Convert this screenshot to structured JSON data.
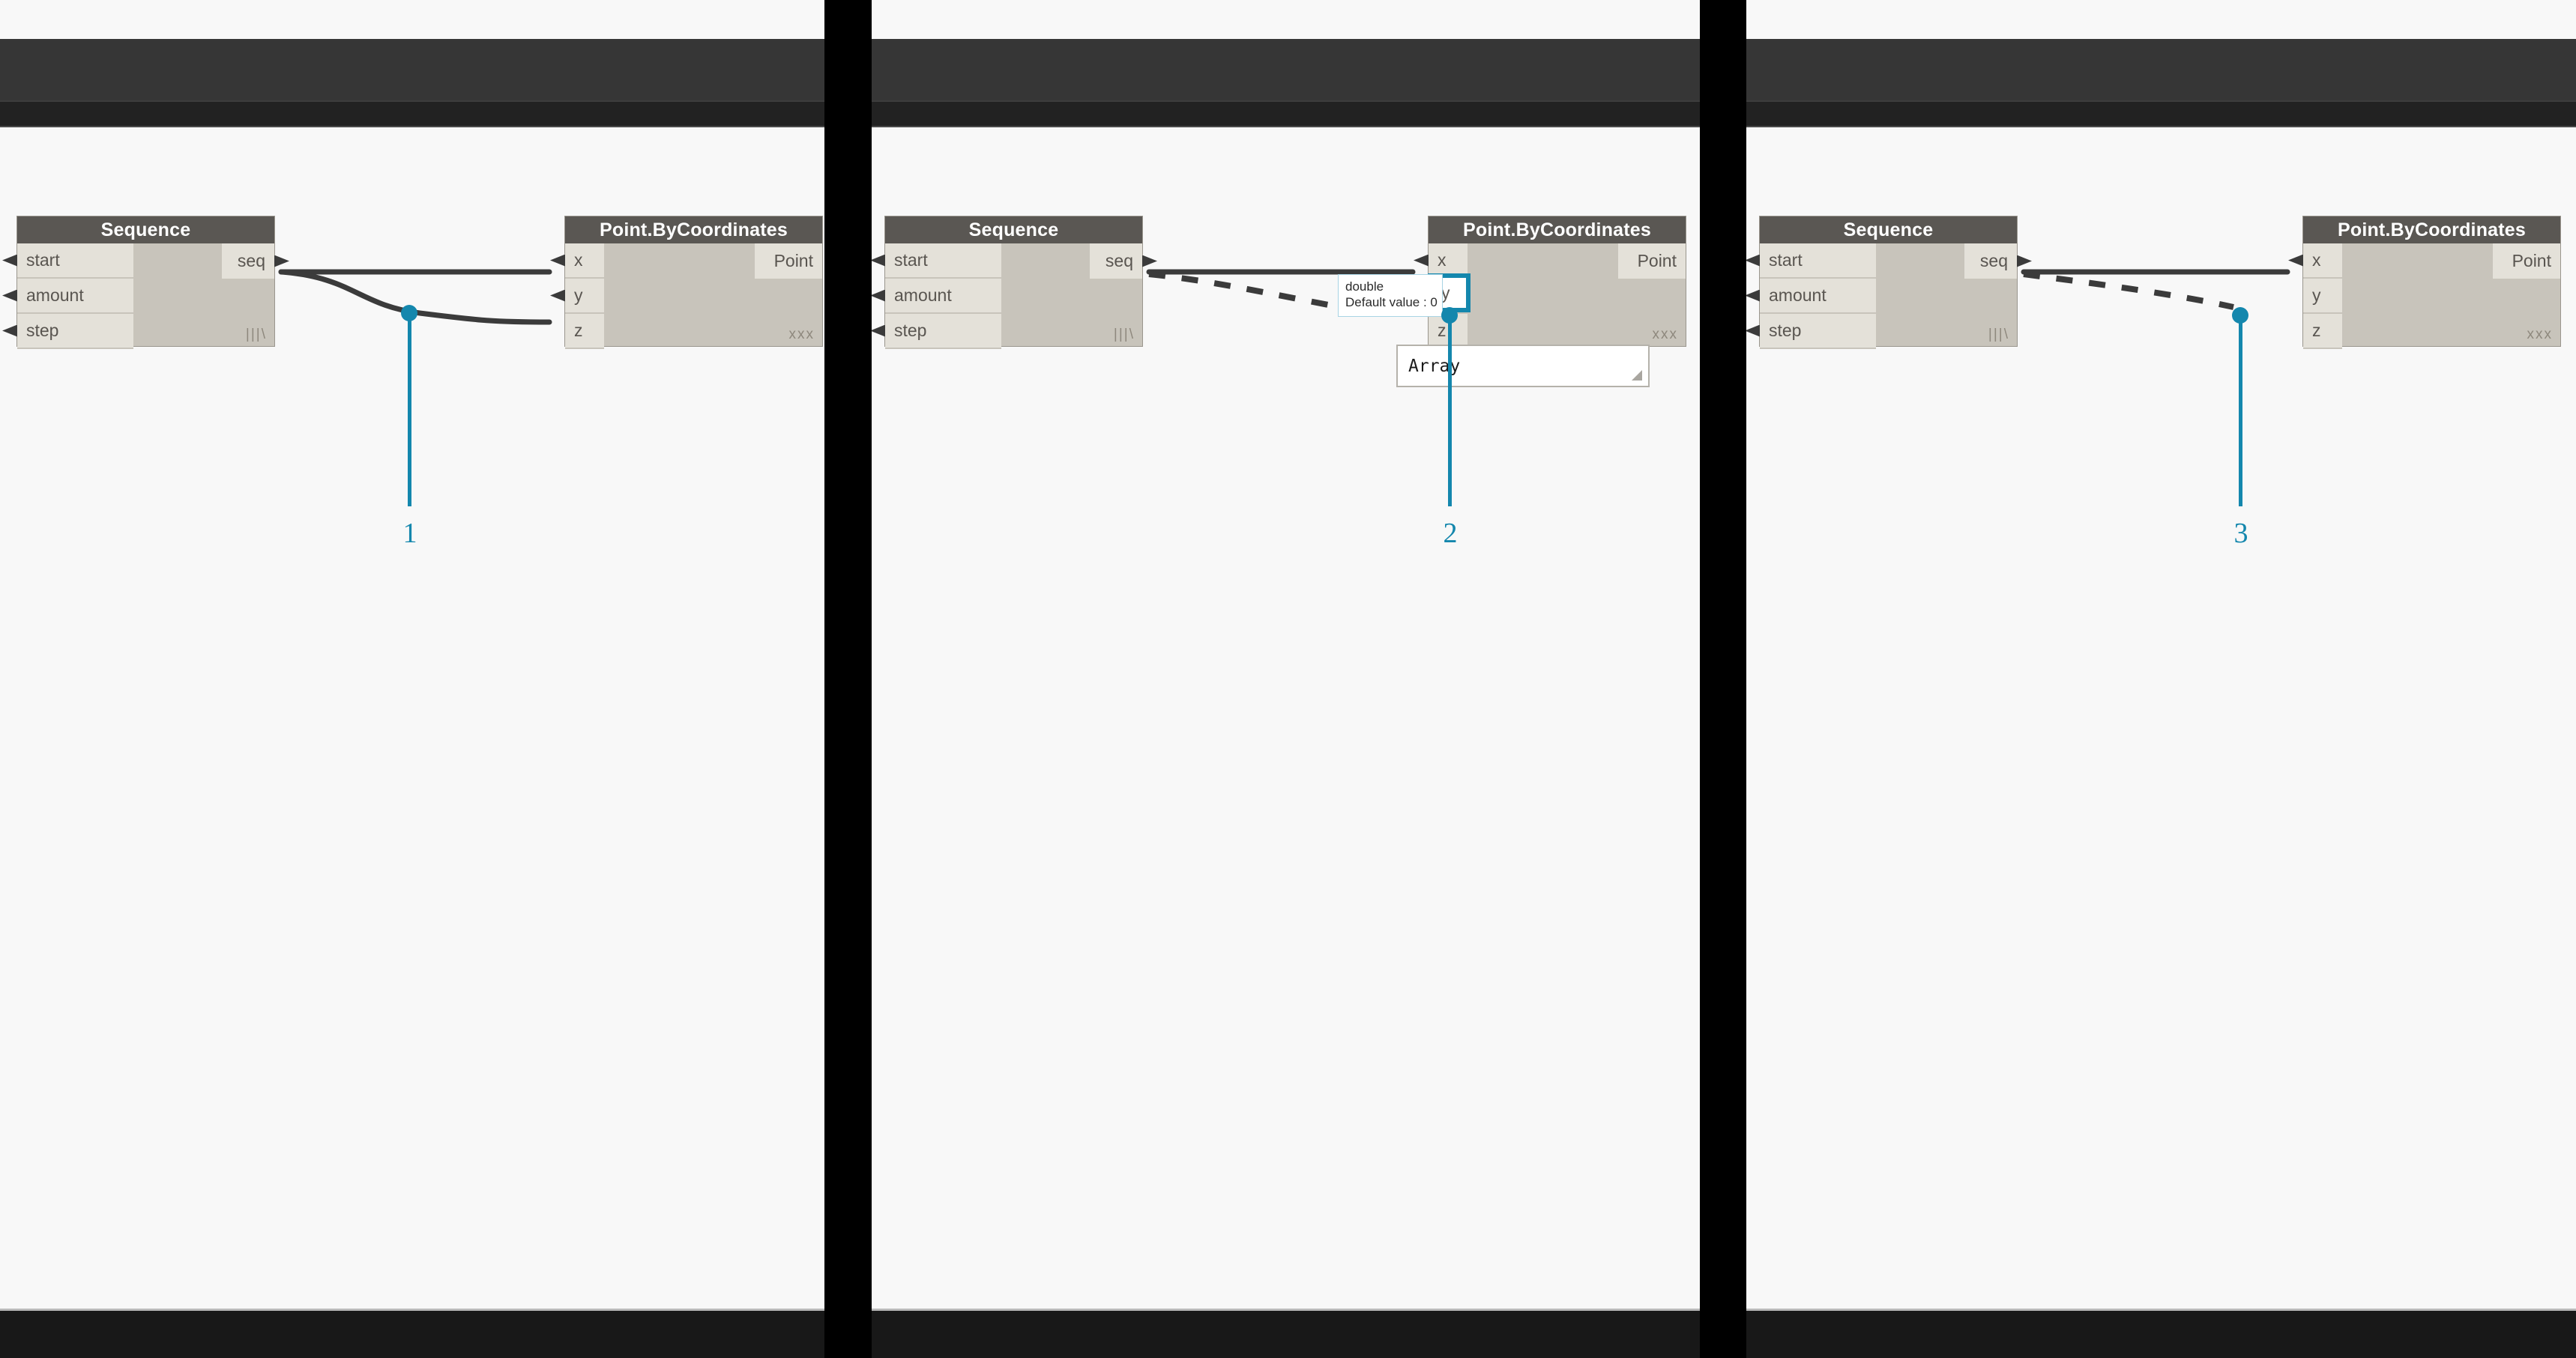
{
  "meta": {
    "title": "Dynamo node wiring sequence",
    "accent_color": "#1487ad",
    "node_header_color": "#5a5753",
    "node_body_color": "#c8c4bb",
    "port_color": "#e4e1d9",
    "wire_color": "#3b3b3b",
    "canvas_color": "#f8f8f8",
    "toolbar_color": "#363636"
  },
  "panels": [
    {
      "id": "panel-1",
      "callout": {
        "number": "1"
      },
      "sequence_node": {
        "title": "Sequence",
        "inputs": [
          "start",
          "amount",
          "step"
        ],
        "outputs": [
          "seq"
        ],
        "lacing": "|||\\"
      },
      "point_node": {
        "title": "Point.ByCoordinates",
        "inputs": [
          "x",
          "y",
          "z"
        ],
        "outputs": [
          "Point"
        ],
        "lacing": "xxx"
      }
    },
    {
      "id": "panel-2",
      "callout": {
        "number": "2"
      },
      "sequence_node": {
        "title": "Sequence",
        "inputs": [
          "start",
          "amount",
          "step"
        ],
        "outputs": [
          "seq"
        ],
        "lacing": "|||\\"
      },
      "point_node": {
        "title": "Point.ByCoordinates",
        "inputs": [
          "x",
          "y",
          "z"
        ],
        "outputs": [
          "Point"
        ],
        "lacing": "xxx"
      },
      "tooltip": {
        "type_line": "double",
        "default_line": "Default value : 0"
      },
      "highlighted_port": "y",
      "code_box": {
        "value": "Array"
      }
    },
    {
      "id": "panel-3",
      "callout": {
        "number": "3"
      },
      "sequence_node": {
        "title": "Sequence",
        "inputs": [
          "start",
          "amount",
          "step"
        ],
        "outputs": [
          "seq"
        ],
        "lacing": "|||\\"
      },
      "point_node": {
        "title": "Point.ByCoordinates",
        "inputs": [
          "x",
          "y",
          "z"
        ],
        "outputs": [
          "Point"
        ],
        "lacing": "xxx"
      }
    }
  ]
}
